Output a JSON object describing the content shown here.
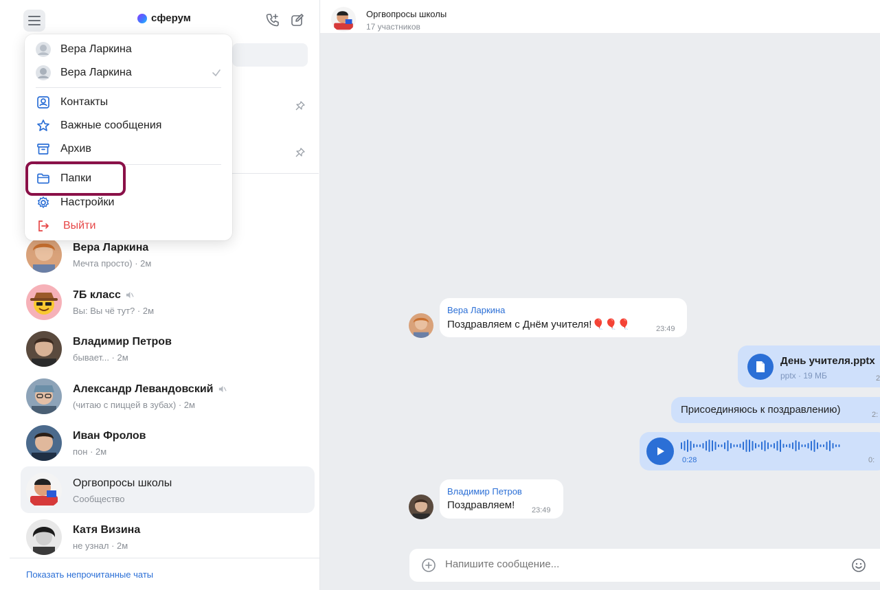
{
  "app": {
    "logo_text": "сферум"
  },
  "menu": {
    "accounts": [
      {
        "name": "Вера Ларкина",
        "selected": false
      },
      {
        "name": "Вера Ларкина",
        "selected": true
      }
    ],
    "items": [
      {
        "label": "Контакты",
        "icon": "contacts-icon"
      },
      {
        "label": "Важные сообщения",
        "icon": "star-icon"
      },
      {
        "label": "Архив",
        "icon": "archive-icon"
      },
      {
        "label": "Папки",
        "icon": "folder-icon"
      },
      {
        "label": "Настройки",
        "icon": "gear-icon"
      },
      {
        "label": "Выйти",
        "icon": "logout-icon"
      }
    ]
  },
  "chats": [
    {
      "title": "Вера Ларкина",
      "subtitle": "Мечта просто)",
      "time": "2м",
      "muted": false
    },
    {
      "title": "7Б класс",
      "you_prefix": "Вы:",
      "subtitle": "Вы чё тут?",
      "time": "2м",
      "muted": true
    },
    {
      "title": "Владимир Петров",
      "subtitle": "бывает...",
      "time": "2м",
      "muted": false
    },
    {
      "title": "Александр Левандовский",
      "subtitle": "(читаю с пиццей в зубах)",
      "time": "2м",
      "muted": true
    },
    {
      "title": "Иван Фролов",
      "subtitle": "пон",
      "time": "2м",
      "muted": false
    },
    {
      "title": "Оргвопросы школы",
      "subtitle": "Сообщество",
      "time": "",
      "muted": false,
      "active": true
    },
    {
      "title": "Катя Визина",
      "subtitle": "не узнал",
      "time": "2м",
      "muted": false
    }
  ],
  "footer": {
    "link": "Показать непрочитанные чаты"
  },
  "conversation": {
    "title": "Оргвопросы школы",
    "members": "17 участников",
    "messages": [
      {
        "sender": "Вера Ларкина",
        "text": "Поздравляем с Днём учителя!🎈🎈🎈",
        "time": "23:49"
      },
      {
        "file_name": "День учителя.pptx",
        "file_meta": "pptx · 19 МБ",
        "time": "2"
      },
      {
        "text": "Присоединяюсь к поздравлению)",
        "time": "2:"
      },
      {
        "voice_elapsed": "0:28",
        "voice_total": "0:",
        "progress": 0.0
      },
      {
        "sender": "Владимир Петров",
        "text": "Поздравляем!",
        "time": "23:49"
      }
    ],
    "composer_placeholder": "Напишите сообщение..."
  },
  "colors": {
    "accent": "#2b6fd6",
    "danger": "#e64646",
    "highlight": "#8a1048",
    "outgoing_bubble": "#cfe0fb",
    "background": "#ebedf0"
  }
}
